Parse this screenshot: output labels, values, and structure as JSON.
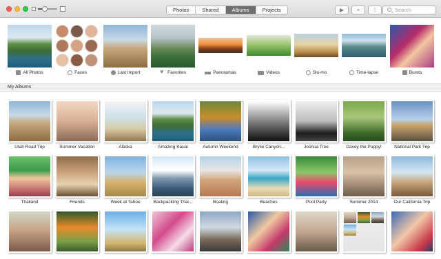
{
  "toolbar": {
    "tabs": [
      {
        "label": "Photos",
        "active": false
      },
      {
        "label": "Shared",
        "active": false
      },
      {
        "label": "Albums",
        "active": true
      },
      {
        "label": "Projects",
        "active": false
      }
    ],
    "buttons": {
      "play": "▶",
      "add": "+",
      "share": "⇧"
    },
    "search": {
      "placeholder": "Search"
    }
  },
  "top_albums": [
    {
      "label": "All Photos",
      "icon": "grid-icon"
    },
    {
      "label": "Faces",
      "icon": "person-icon"
    },
    {
      "label": "Last Import",
      "icon": "clock-icon"
    },
    {
      "label": "Favorites",
      "icon": "heart-icon"
    },
    {
      "label": "Panoramas",
      "icon": "panorama-icon"
    },
    {
      "label": "Videos",
      "icon": "video-icon"
    },
    {
      "label": "Slo-mo",
      "icon": "slomo-icon"
    },
    {
      "label": "Time-lapse",
      "icon": "timelapse-icon"
    },
    {
      "label": "Bursts",
      "icon": "stack-icon"
    }
  ],
  "section": {
    "title": "My Albums"
  },
  "albums": [
    {
      "label": "Utah Road Trip"
    },
    {
      "label": "Summer Vacation"
    },
    {
      "label": "Alaska"
    },
    {
      "label": "Amazing Kauai"
    },
    {
      "label": "Autumn Weekend"
    },
    {
      "label": "Bryce Canyon..."
    },
    {
      "label": "Joshua Tree"
    },
    {
      "label": "Davey the Puppy!"
    },
    {
      "label": "National Park Trip"
    },
    {
      "label": "Thailand"
    },
    {
      "label": "Friends"
    },
    {
      "label": "Week at Tahoe"
    },
    {
      "label": "Backpacking Thai..."
    },
    {
      "label": "Boating"
    },
    {
      "label": "Beaches"
    },
    {
      "label": "Pool Party"
    },
    {
      "label": "Summer 2014"
    },
    {
      "label": "Our California Trip"
    }
  ],
  "colors": {
    "active_tab": "#6f6f6f",
    "close": "#fc605c",
    "minimize": "#fdbc40",
    "maximize": "#34c84a"
  }
}
